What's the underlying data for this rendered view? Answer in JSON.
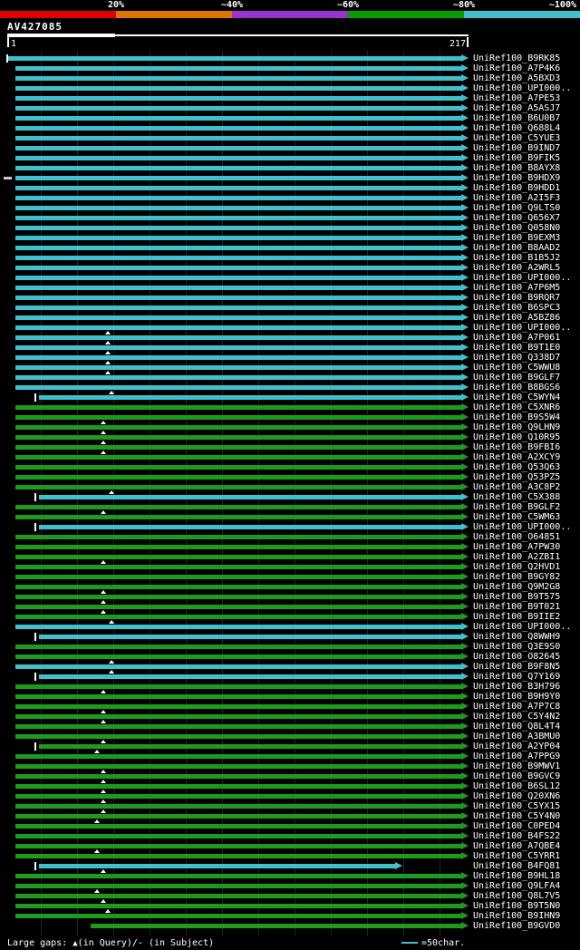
{
  "colors": {
    "background": "#000000",
    "text": "#ffffff",
    "bar_cyan": "#40c0cc",
    "bar_green": "#1e9a1e",
    "gridline": "#222222",
    "ruler": "#ffffff",
    "subject_gap_dash": "#5599ff"
  },
  "footer": {
    "gaps_prefix": "Large gaps: ",
    "query_gap_symbol": "▲",
    "query_gap_text": "(in Query)/",
    "subject_gap_symbol": "-",
    "subject_gap_text": " (in Subject)",
    "scale_label": "=50char."
  },
  "chart_data": {
    "type": "table",
    "title": "AV427085",
    "query": {
      "name": "AV427085",
      "start": 1,
      "end": 217,
      "start_label": "1",
      "end_label": "217"
    },
    "identity_legend": [
      {
        "label": "20%",
        "color": "#dd0000"
      },
      {
        "label": "~40%",
        "color": "#dd7700"
      },
      {
        "label": "~60%",
        "color": "#9933cc"
      },
      {
        "label": "~80%",
        "color": "#00a000"
      },
      {
        "label": "~100%",
        "color": "#40c0cc"
      }
    ],
    "hit_prefix": "UniRef100_",
    "rows": [
      {
        "acc": "B9RK85",
        "color": "cyan",
        "from": 1,
        "to": 217,
        "tick": 1
      },
      {
        "acc": "A7P4K6",
        "color": "cyan",
        "from": 5,
        "to": 217
      },
      {
        "acc": "A5BXD3",
        "color": "cyan",
        "from": 5,
        "to": 217
      },
      {
        "acc": "UPI000..",
        "color": "cyan",
        "from": 5,
        "to": 217
      },
      {
        "acc": "A7PE53",
        "color": "cyan",
        "from": 5,
        "to": 217
      },
      {
        "acc": "A5ASJ7",
        "color": "cyan",
        "from": 5,
        "to": 217
      },
      {
        "acc": "B6U0B7",
        "color": "cyan",
        "from": 5,
        "to": 217
      },
      {
        "acc": "Q688L4",
        "color": "cyan",
        "from": 5,
        "to": 217
      },
      {
        "acc": "C5YUE3",
        "color": "cyan",
        "from": 5,
        "to": 217
      },
      {
        "acc": "B9IND7",
        "color": "cyan",
        "from": 5,
        "to": 217
      },
      {
        "acc": "B9FIK5",
        "color": "cyan",
        "from": 5,
        "to": 217
      },
      {
        "acc": "B8AYX8",
        "color": "cyan",
        "from": 5,
        "to": 217
      },
      {
        "acc": "B9HDX9",
        "color": "cyan",
        "from": 5,
        "to": 217,
        "dash": true
      },
      {
        "acc": "B9HDD1",
        "color": "cyan",
        "from": 5,
        "to": 217
      },
      {
        "acc": "A2I5F3",
        "color": "cyan",
        "from": 5,
        "to": 217
      },
      {
        "acc": "Q9LTS0",
        "color": "cyan",
        "from": 5,
        "to": 217
      },
      {
        "acc": "Q656X7",
        "color": "cyan",
        "from": 5,
        "to": 217
      },
      {
        "acc": "Q058N0",
        "color": "cyan",
        "from": 5,
        "to": 217
      },
      {
        "acc": "B9EXM3",
        "color": "cyan",
        "from": 5,
        "to": 217
      },
      {
        "acc": "B8AAD2",
        "color": "cyan",
        "from": 5,
        "to": 217
      },
      {
        "acc": "B1B5J2",
        "color": "cyan",
        "from": 5,
        "to": 217
      },
      {
        "acc": "A2WRL5",
        "color": "cyan",
        "from": 5,
        "to": 217
      },
      {
        "acc": "UPI000..",
        "color": "cyan",
        "from": 5,
        "to": 217
      },
      {
        "acc": "A7P6M5",
        "color": "cyan",
        "from": 5,
        "to": 217
      },
      {
        "acc": "B9RQR7",
        "color": "cyan",
        "from": 5,
        "to": 217
      },
      {
        "acc": "B6SPC3",
        "color": "cyan",
        "from": 5,
        "to": 217
      },
      {
        "acc": "A5BZ86",
        "color": "cyan",
        "from": 5,
        "to": 217
      },
      {
        "acc": "UPI000..",
        "color": "cyan",
        "from": 5,
        "to": 217
      },
      {
        "acc": "A7P061",
        "color": "cyan",
        "from": 5,
        "to": 217,
        "gap": 48
      },
      {
        "acc": "B9T1E0",
        "color": "cyan",
        "from": 5,
        "to": 217,
        "gap": 48
      },
      {
        "acc": "Q338D7",
        "color": "cyan",
        "from": 5,
        "to": 217,
        "gap": 48
      },
      {
        "acc": "C5WWU8",
        "color": "cyan",
        "from": 5,
        "to": 217,
        "gap": 48
      },
      {
        "acc": "B9GLF7",
        "color": "cyan",
        "from": 5,
        "to": 217,
        "gap": 48
      },
      {
        "acc": "B8BGS6",
        "color": "cyan",
        "from": 5,
        "to": 217
      },
      {
        "acc": "C5WYN4",
        "color": "cyan",
        "from": 16,
        "to": 217,
        "tick": 14,
        "gap": 50
      },
      {
        "acc": "C5XNR6",
        "color": "green",
        "from": 5,
        "to": 217
      },
      {
        "acc": "B9S5W4",
        "color": "green",
        "from": 5,
        "to": 217
      },
      {
        "acc": "Q9LHN9",
        "color": "green",
        "from": 5,
        "to": 217,
        "gap": 46
      },
      {
        "acc": "Q10R95",
        "color": "green",
        "from": 5,
        "to": 217,
        "gap": 46
      },
      {
        "acc": "B9FBI6",
        "color": "green",
        "from": 5,
        "to": 217,
        "gap": 46
      },
      {
        "acc": "A2XCY9",
        "color": "green",
        "from": 5,
        "to": 217,
        "gap": 46
      },
      {
        "acc": "Q53Q63",
        "color": "green",
        "from": 5,
        "to": 217
      },
      {
        "acc": "Q53PZ5",
        "color": "green",
        "from": 5,
        "to": 217
      },
      {
        "acc": "A3C8P2",
        "color": "green",
        "from": 5,
        "to": 217
      },
      {
        "acc": "C5X388",
        "color": "cyan",
        "from": 16,
        "to": 217,
        "tick": 14,
        "gap": 50
      },
      {
        "acc": "B9GLF2",
        "color": "green",
        "from": 5,
        "to": 217
      },
      {
        "acc": "C5WM63",
        "color": "green",
        "from": 5,
        "to": 217,
        "gap": 46
      },
      {
        "acc": "UPI000..",
        "color": "cyan",
        "from": 16,
        "to": 217,
        "tick": 14
      },
      {
        "acc": "O64851",
        "color": "green",
        "from": 5,
        "to": 217
      },
      {
        "acc": "A7PW30",
        "color": "green",
        "from": 5,
        "to": 217
      },
      {
        "acc": "A2ZBI1",
        "color": "green",
        "from": 5,
        "to": 217
      },
      {
        "acc": "Q2HVD1",
        "color": "green",
        "from": 5,
        "to": 217,
        "gap": 46
      },
      {
        "acc": "B9GY82",
        "color": "green",
        "from": 5,
        "to": 217
      },
      {
        "acc": "Q9M2G8",
        "color": "green",
        "from": 5,
        "to": 217
      },
      {
        "acc": "B9T575",
        "color": "green",
        "from": 5,
        "to": 217,
        "gap": 46
      },
      {
        "acc": "B9T021",
        "color": "green",
        "from": 5,
        "to": 217,
        "gap": 46
      },
      {
        "acc": "B9IIE2",
        "color": "green",
        "from": 5,
        "to": 217,
        "gap": 46
      },
      {
        "acc": "UPI000..",
        "color": "cyan",
        "from": 5,
        "to": 217,
        "gap": 50
      },
      {
        "acc": "Q8WWH9",
        "color": "cyan",
        "from": 16,
        "to": 217,
        "tick": 14
      },
      {
        "acc": "Q3E9S0",
        "color": "green",
        "from": 5,
        "to": 217
      },
      {
        "acc": "O82645",
        "color": "green",
        "from": 5,
        "to": 217
      },
      {
        "acc": "B9F8N5",
        "color": "cyan",
        "from": 5,
        "to": 217,
        "gap": 50
      },
      {
        "acc": "Q7Y169",
        "color": "cyan",
        "from": 16,
        "to": 217,
        "tick": 14,
        "gap": 50
      },
      {
        "acc": "B3H796",
        "color": "green",
        "from": 5,
        "to": 217
      },
      {
        "acc": "B9H9Y0",
        "color": "green",
        "from": 5,
        "to": 217,
        "gap": 46
      },
      {
        "acc": "A7P7C8",
        "color": "green",
        "from": 5,
        "to": 217
      },
      {
        "acc": "C5Y4N2",
        "color": "green",
        "from": 5,
        "to": 217,
        "gap": 46
      },
      {
        "acc": "Q8L4T4",
        "color": "green",
        "from": 5,
        "to": 217,
        "gap": 46
      },
      {
        "acc": "A3BMU0",
        "color": "green",
        "from": 5,
        "to": 217
      },
      {
        "acc": "A2YP04",
        "color": "green",
        "from": 16,
        "to": 217,
        "tick": 14,
        "gap": 46
      },
      {
        "acc": "A7PPG9",
        "color": "green",
        "from": 5,
        "to": 217,
        "gap": 43
      },
      {
        "acc": "B9MWV1",
        "color": "green",
        "from": 5,
        "to": 217
      },
      {
        "acc": "B9GVC9",
        "color": "green",
        "from": 5,
        "to": 217,
        "gap": 46
      },
      {
        "acc": "B6SL12",
        "color": "green",
        "from": 5,
        "to": 217,
        "gap": 46
      },
      {
        "acc": "Q20XN6",
        "color": "green",
        "from": 5,
        "to": 217,
        "gap": 46
      },
      {
        "acc": "C5YX15",
        "color": "green",
        "from": 5,
        "to": 217,
        "gap": 46
      },
      {
        "acc": "C5Y4N0",
        "color": "green",
        "from": 5,
        "to": 217,
        "gap": 46
      },
      {
        "acc": "C0PED4",
        "color": "green",
        "from": 5,
        "to": 217,
        "gap": 43
      },
      {
        "acc": "B4FS22",
        "color": "green",
        "from": 5,
        "to": 217
      },
      {
        "acc": "A7QBE4",
        "color": "green",
        "from": 5,
        "to": 217
      },
      {
        "acc": "C5YRR1",
        "color": "green",
        "from": 5,
        "to": 217,
        "gap": 43
      },
      {
        "acc": "B4FQ81",
        "color": "cyan",
        "from": 16,
        "to": 186,
        "tick": 14
      },
      {
        "acc": "B9HL18",
        "color": "green",
        "from": 5,
        "to": 217,
        "gap": 46
      },
      {
        "acc": "Q9LFA4",
        "color": "green",
        "from": 5,
        "to": 217
      },
      {
        "acc": "Q8L7V5",
        "color": "green",
        "from": 5,
        "to": 217,
        "gap": 43
      },
      {
        "acc": "B9T5N0",
        "color": "green",
        "from": 5,
        "to": 217,
        "gap": 46
      },
      {
        "acc": "B9IHN9",
        "color": "green",
        "from": 5,
        "to": 217,
        "gap": 48
      },
      {
        "acc": "B9GVD0",
        "color": "green",
        "from": 40,
        "to": 217
      }
    ]
  }
}
